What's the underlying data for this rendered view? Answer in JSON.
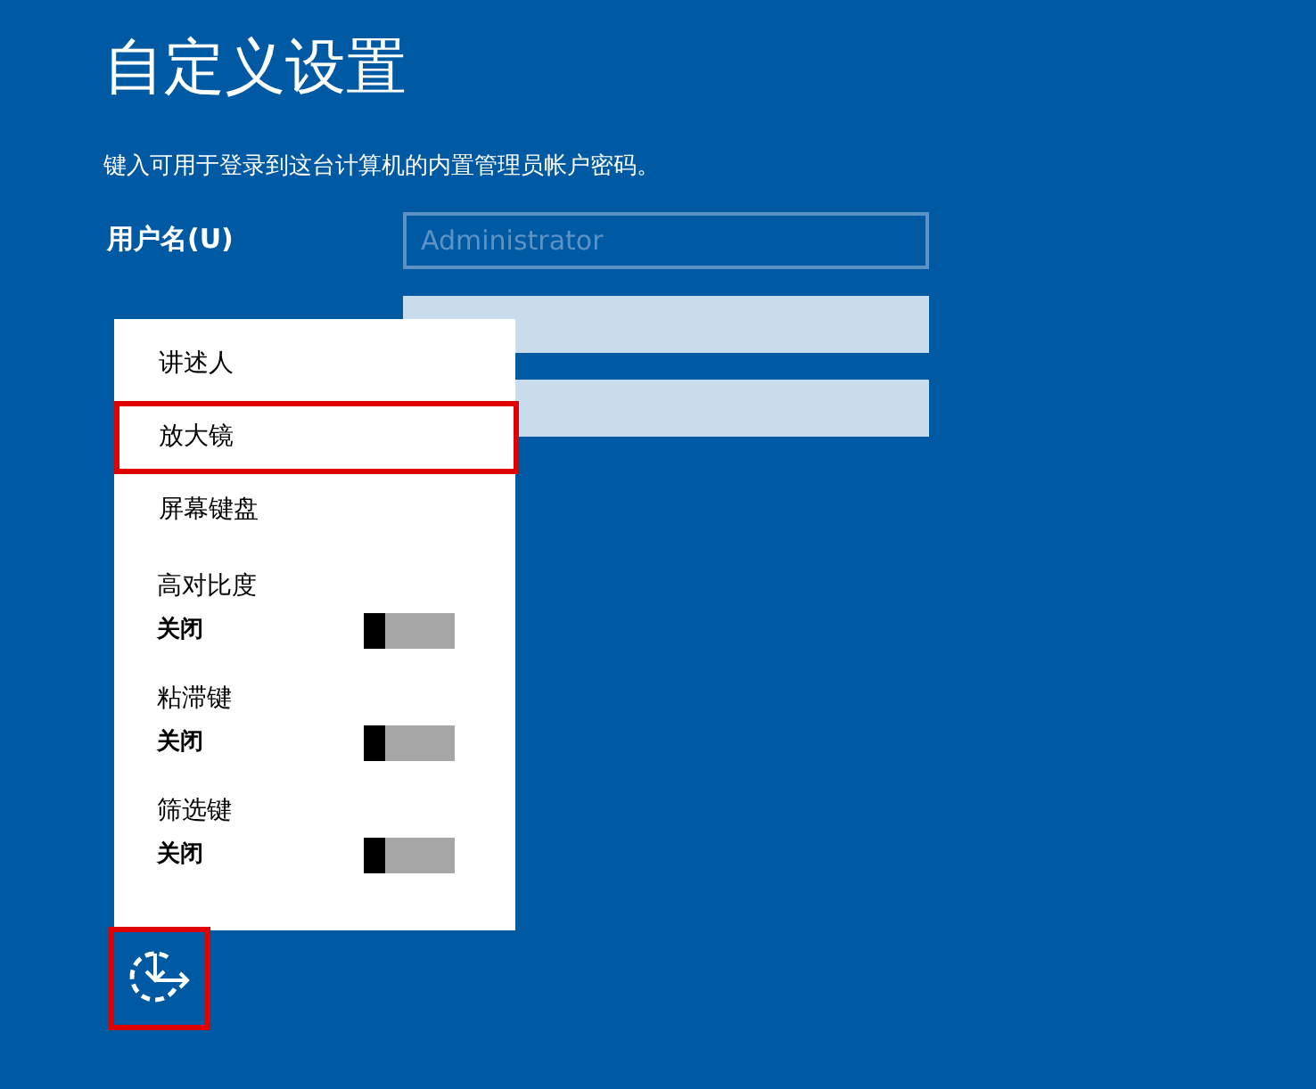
{
  "title": "自定义设置",
  "instruction": "键入可用于登录到这台计算机的内置管理员帐户密码。",
  "fields": [
    {
      "label": "用户名(U)",
      "placeholder": "Administrator",
      "disabled": true
    },
    {
      "disabled": false
    },
    {
      "disabled": false
    }
  ],
  "menu": {
    "items": [
      {
        "kind": "link",
        "label": "讲述人",
        "highlighted": false
      },
      {
        "kind": "link",
        "label": "放大镜",
        "highlighted": true
      },
      {
        "kind": "link",
        "label": "屏幕键盘",
        "highlighted": false
      },
      {
        "kind": "toggle",
        "label": "高对比度",
        "state": "关闭",
        "on": false
      },
      {
        "kind": "toggle",
        "label": "粘滞键",
        "state": "关闭",
        "on": false
      },
      {
        "kind": "toggle",
        "label": "筛选键",
        "state": "关闭",
        "on": false
      }
    ]
  },
  "ease_button": {
    "highlighted": true
  }
}
